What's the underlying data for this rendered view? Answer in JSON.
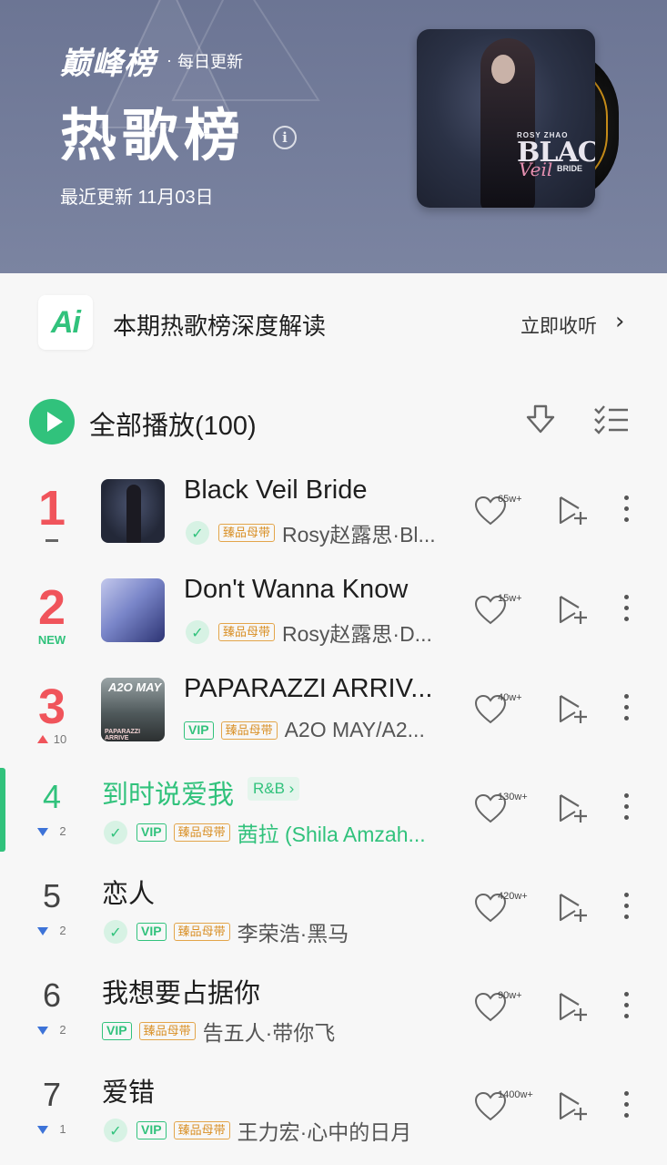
{
  "header": {
    "brand_logo": "巅峰榜",
    "brand_dot": "·",
    "brand_sub": "每日更新",
    "title": "热歌榜",
    "info_icon": "i",
    "updated": "最近更新 11月03日",
    "cover_text": {
      "top": "ROSY ZHAO",
      "big": "BLACK",
      "veil": "Veil",
      "small": "BRIDE"
    },
    "accent_color": "#6c7594"
  },
  "ai_banner": {
    "badge": "Ai",
    "title": "本期热歌榜深度解读",
    "action": "立即收听",
    "chevron": "›"
  },
  "toolbar": {
    "play_all_label": "全部播放(100)",
    "download_icon": "download-icon",
    "multi_select_icon": "multi-select-icon"
  },
  "colors": {
    "green": "#31c27c",
    "red": "#f0545b",
    "gold": "#e3a54a",
    "blue": "#3d73d8"
  },
  "songs": [
    {
      "rank": "1",
      "trend": "same",
      "trend_value": "",
      "title": "Black Veil Bride",
      "genre": "",
      "has_check": true,
      "vip": false,
      "quality": "臻品母带",
      "artist": "Rosy赵露思·Bl...",
      "likes": "65w+",
      "playing": false
    },
    {
      "rank": "2",
      "trend": "new",
      "trend_value": "NEW",
      "title": "Don't Wanna Know",
      "genre": "",
      "has_check": true,
      "vip": false,
      "quality": "臻品母带",
      "artist": "Rosy赵露思·D...",
      "likes": "15w+",
      "playing": false
    },
    {
      "rank": "3",
      "trend": "up",
      "trend_value": "10",
      "title": "PAPARAZZI ARRIV...",
      "genre": "",
      "has_check": false,
      "vip": true,
      "vip_label": "VIP",
      "quality": "臻品母带",
      "artist": "A2O MAY/A2...",
      "likes": "40w+",
      "playing": false
    },
    {
      "rank": "4",
      "trend": "down",
      "trend_value": "2",
      "title": "到时说爱我",
      "genre": "R&B ›",
      "has_check": true,
      "vip": true,
      "vip_label": "VIP",
      "quality": "臻品母带",
      "artist": "茜拉 (Shila Amzah...",
      "likes": "130w+",
      "playing": true
    },
    {
      "rank": "5",
      "trend": "down",
      "trend_value": "2",
      "title": "恋人",
      "genre": "",
      "has_check": true,
      "vip": true,
      "vip_label": "VIP",
      "quality": "臻品母带",
      "artist": "李荣浩·黑马",
      "likes": "420w+",
      "playing": false
    },
    {
      "rank": "6",
      "trend": "down",
      "trend_value": "2",
      "title": "我想要占据你",
      "genre": "",
      "has_check": false,
      "vip": true,
      "vip_label": "VIP",
      "quality": "臻品母带",
      "artist": "告五人·带你飞",
      "likes": "90w+",
      "playing": false
    },
    {
      "rank": "7",
      "trend": "down",
      "trend_value": "1",
      "title": "爱错",
      "genre": "",
      "has_check": true,
      "vip": true,
      "vip_label": "VIP",
      "quality": "臻品母带",
      "artist": "王力宏·心中的日月",
      "likes": "1400w+",
      "playing": false
    }
  ],
  "thumb_text": {
    "t3_title": "A2O MAY",
    "t3_sub": "PAPARAZZI ARRIVE"
  }
}
